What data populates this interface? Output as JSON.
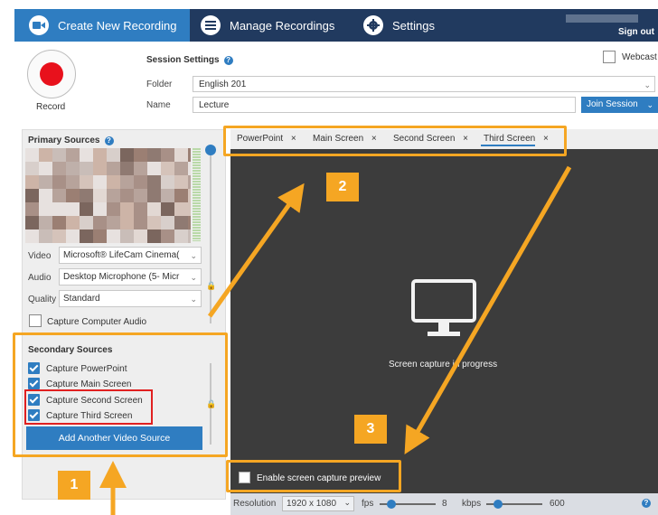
{
  "topbar": {
    "tabs": [
      {
        "label": "Create New Recording",
        "icon": "video-camera-icon"
      },
      {
        "label": "Manage Recordings",
        "icon": "list-icon"
      },
      {
        "label": "Settings",
        "icon": "gear-icon"
      }
    ],
    "sign_out": "Sign out"
  },
  "record": {
    "label": "Record"
  },
  "session": {
    "title": "Session Settings",
    "folder_label": "Folder",
    "folder_value": "English 201",
    "name_label": "Name",
    "name_value": "Lecture",
    "join_label": "Join Session",
    "webcast_label": "Webcast"
  },
  "primary_sources": {
    "title": "Primary Sources",
    "video_label": "Video",
    "video_value": "Microsoft® LifeCam Cinema(",
    "audio_label": "Audio",
    "audio_value": "Desktop Microphone (5- Micr",
    "quality_label": "Quality",
    "quality_value": "Standard",
    "capture_audio_label": "Capture Computer Audio"
  },
  "secondary_sources": {
    "title": "Secondary Sources",
    "items": [
      {
        "label": "Capture PowerPoint",
        "checked": true
      },
      {
        "label": "Capture Main Screen",
        "checked": true
      },
      {
        "label": "Capture Second Screen",
        "checked": true
      },
      {
        "label": "Capture Third Screen",
        "checked": true
      }
    ],
    "add_button": "Add Another Video Source"
  },
  "preview": {
    "tabs": [
      {
        "label": "PowerPoint",
        "close": "×"
      },
      {
        "label": "Main Screen",
        "close": "×"
      },
      {
        "label": "Second Screen",
        "close": "×"
      },
      {
        "label": "Third Screen",
        "close": "×",
        "selected": true
      }
    ],
    "message": "Screen capture in progress",
    "enable_preview_label": "Enable screen capture preview",
    "resolution_label": "Resolution",
    "resolution_value": "1920 x 1080",
    "fps_label": "fps",
    "fps_value": "8",
    "kbps_label": "kbps",
    "kbps_value": "600"
  },
  "annotations": {
    "badges": [
      "1",
      "2",
      "3"
    ],
    "highlight_color": "#f5a623",
    "red_box_color": "#e02020"
  },
  "colors": {
    "accent": "#2f7dc1",
    "topbar": "#213a5f",
    "record": "#e8111c",
    "preview_bg": "#3c3c3c"
  }
}
